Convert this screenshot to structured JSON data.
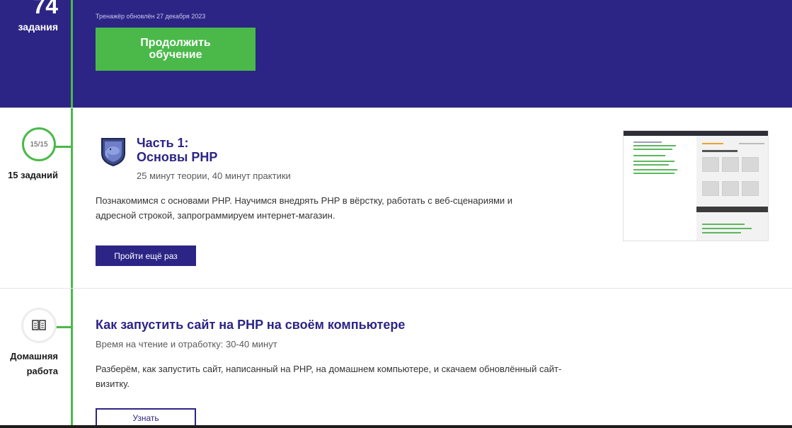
{
  "hero": {
    "count": "74",
    "count_unit": "задания",
    "updated": "Тренажёр обновлён 27 декабря 2023",
    "continue_label": "Продолжить обучение"
  },
  "part1": {
    "progress": "15/15",
    "tasks_count": "15 заданий",
    "title_line1": "Часть 1:",
    "title_line2": "Основы PHP",
    "meta": "25 минут теории, 40 минут практики",
    "description": "Познакомимся с основами PHP. Научимся внедрять PHP в вёрстку, работать с веб-сценариями и адресной строкой, запрограммируем интернет-магазин.",
    "retry_label": "Пройти ещё раз"
  },
  "homework": {
    "label_line1": "Домашняя",
    "label_line2": "работа",
    "icon": "book-icon",
    "title": "Как запустить сайт на PHP на своём компьютере",
    "meta": "Время на чтение и отработку: 30-40 минут",
    "description": "Разберём, как запустить сайт, написанный на PHP, на домашнем компьютере, и скачаем обновлённый сайт-визитку.",
    "learn_label": "Узнать"
  },
  "colors": {
    "brand": "#2c2585",
    "accent": "#4ab94a"
  }
}
